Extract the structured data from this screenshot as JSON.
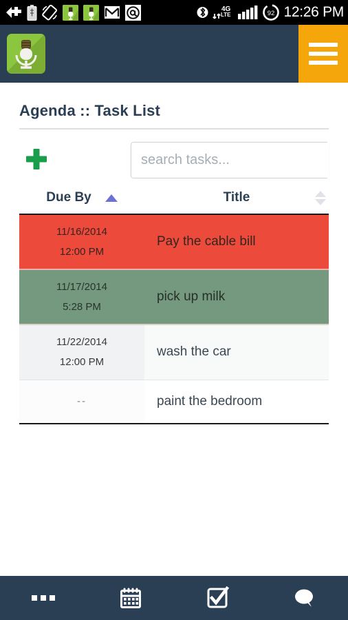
{
  "statusbar": {
    "time": "12:26 PM",
    "battery_level": "92",
    "network": "4G LTE",
    "icons_left": [
      "back-arrow-plus-icon",
      "battery-medical-icon",
      "rotate-screen-icon",
      "android-app-green-icon",
      "android-app-green-icon-2",
      "gmail-icon",
      "email-at-icon"
    ],
    "icons_right": [
      "bluetooth-icon",
      "4glte-data-icon",
      "signal-bars-icon",
      "battery-circle-icon"
    ]
  },
  "header": {
    "logo_name": "microphone-app-logo",
    "menu_label": "hamburger-menu",
    "bg_color": "#2b3f54",
    "menu_color": "#f5a60a"
  },
  "page": {
    "title": "Agenda :: Task List"
  },
  "toolbar": {
    "add_label": "add-task",
    "search_placeholder": "search tasks...",
    "search_value": "",
    "clear_label": "clear-search"
  },
  "table": {
    "columns": [
      {
        "key": "due",
        "label": "Due By",
        "sort": "asc",
        "sort_color": "#6b72d4"
      },
      {
        "key": "title",
        "label": "Title",
        "sort": "none",
        "sort_color": "#dfe2e6"
      }
    ],
    "rows": [
      {
        "date": "11/16/2014",
        "time": "12:00 PM",
        "title": "Pay the cable bill",
        "state": "overdue",
        "color": "#ec4b3b"
      },
      {
        "date": "11/17/2014",
        "time": "5:28 PM",
        "title": "pick up milk",
        "state": "due-soon",
        "color": "#74997e"
      },
      {
        "date": "11/22/2014",
        "time": "12:00 PM",
        "title": "wash the car",
        "state": "upcoming",
        "color": "#f1f2f3"
      },
      {
        "date": "--",
        "time": "",
        "title": "paint the bedroom",
        "state": "no-date",
        "color": "#ffffff"
      }
    ]
  },
  "bottomnav": {
    "items": [
      {
        "icon": "ellipsis-more-icon",
        "label": "more"
      },
      {
        "icon": "calendar-icon",
        "label": "calendar"
      },
      {
        "icon": "checkbox-checked-icon",
        "label": "tasks"
      },
      {
        "icon": "speech-bubble-icon",
        "label": "messages"
      }
    ]
  }
}
